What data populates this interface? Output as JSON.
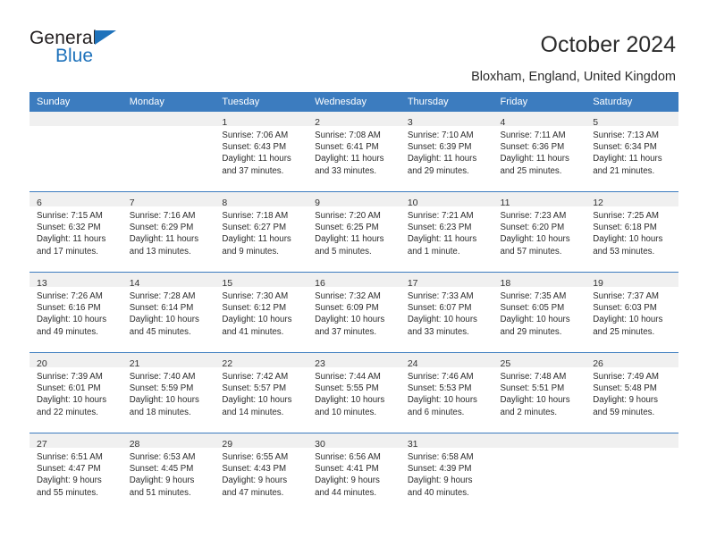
{
  "brand": {
    "name_top": "General",
    "name_bottom": "Blue",
    "accent_color": "#1e72bb",
    "triangle_icon": "triangle-icon"
  },
  "header": {
    "title": "October 2024",
    "location": "Bloxham, England, United Kingdom"
  },
  "calendar": {
    "header_bg": "#3c7cbf",
    "daynum_bg": "#f0f0f0",
    "weekdays": [
      "Sunday",
      "Monday",
      "Tuesday",
      "Wednesday",
      "Thursday",
      "Friday",
      "Saturday"
    ],
    "weeks": [
      [
        {
          "empty": true
        },
        {
          "empty": true
        },
        {
          "day": "1",
          "sunrise": "Sunrise: 7:06 AM",
          "sunset": "Sunset: 6:43 PM",
          "daylight": "Daylight: 11 hours and 37 minutes."
        },
        {
          "day": "2",
          "sunrise": "Sunrise: 7:08 AM",
          "sunset": "Sunset: 6:41 PM",
          "daylight": "Daylight: 11 hours and 33 minutes."
        },
        {
          "day": "3",
          "sunrise": "Sunrise: 7:10 AM",
          "sunset": "Sunset: 6:39 PM",
          "daylight": "Daylight: 11 hours and 29 minutes."
        },
        {
          "day": "4",
          "sunrise": "Sunrise: 7:11 AM",
          "sunset": "Sunset: 6:36 PM",
          "daylight": "Daylight: 11 hours and 25 minutes."
        },
        {
          "day": "5",
          "sunrise": "Sunrise: 7:13 AM",
          "sunset": "Sunset: 6:34 PM",
          "daylight": "Daylight: 11 hours and 21 minutes."
        }
      ],
      [
        {
          "day": "6",
          "sunrise": "Sunrise: 7:15 AM",
          "sunset": "Sunset: 6:32 PM",
          "daylight": "Daylight: 11 hours and 17 minutes."
        },
        {
          "day": "7",
          "sunrise": "Sunrise: 7:16 AM",
          "sunset": "Sunset: 6:29 PM",
          "daylight": "Daylight: 11 hours and 13 minutes."
        },
        {
          "day": "8",
          "sunrise": "Sunrise: 7:18 AM",
          "sunset": "Sunset: 6:27 PM",
          "daylight": "Daylight: 11 hours and 9 minutes."
        },
        {
          "day": "9",
          "sunrise": "Sunrise: 7:20 AM",
          "sunset": "Sunset: 6:25 PM",
          "daylight": "Daylight: 11 hours and 5 minutes."
        },
        {
          "day": "10",
          "sunrise": "Sunrise: 7:21 AM",
          "sunset": "Sunset: 6:23 PM",
          "daylight": "Daylight: 11 hours and 1 minute."
        },
        {
          "day": "11",
          "sunrise": "Sunrise: 7:23 AM",
          "sunset": "Sunset: 6:20 PM",
          "daylight": "Daylight: 10 hours and 57 minutes."
        },
        {
          "day": "12",
          "sunrise": "Sunrise: 7:25 AM",
          "sunset": "Sunset: 6:18 PM",
          "daylight": "Daylight: 10 hours and 53 minutes."
        }
      ],
      [
        {
          "day": "13",
          "sunrise": "Sunrise: 7:26 AM",
          "sunset": "Sunset: 6:16 PM",
          "daylight": "Daylight: 10 hours and 49 minutes."
        },
        {
          "day": "14",
          "sunrise": "Sunrise: 7:28 AM",
          "sunset": "Sunset: 6:14 PM",
          "daylight": "Daylight: 10 hours and 45 minutes."
        },
        {
          "day": "15",
          "sunrise": "Sunrise: 7:30 AM",
          "sunset": "Sunset: 6:12 PM",
          "daylight": "Daylight: 10 hours and 41 minutes."
        },
        {
          "day": "16",
          "sunrise": "Sunrise: 7:32 AM",
          "sunset": "Sunset: 6:09 PM",
          "daylight": "Daylight: 10 hours and 37 minutes."
        },
        {
          "day": "17",
          "sunrise": "Sunrise: 7:33 AM",
          "sunset": "Sunset: 6:07 PM",
          "daylight": "Daylight: 10 hours and 33 minutes."
        },
        {
          "day": "18",
          "sunrise": "Sunrise: 7:35 AM",
          "sunset": "Sunset: 6:05 PM",
          "daylight": "Daylight: 10 hours and 29 minutes."
        },
        {
          "day": "19",
          "sunrise": "Sunrise: 7:37 AM",
          "sunset": "Sunset: 6:03 PM",
          "daylight": "Daylight: 10 hours and 25 minutes."
        }
      ],
      [
        {
          "day": "20",
          "sunrise": "Sunrise: 7:39 AM",
          "sunset": "Sunset: 6:01 PM",
          "daylight": "Daylight: 10 hours and 22 minutes."
        },
        {
          "day": "21",
          "sunrise": "Sunrise: 7:40 AM",
          "sunset": "Sunset: 5:59 PM",
          "daylight": "Daylight: 10 hours and 18 minutes."
        },
        {
          "day": "22",
          "sunrise": "Sunrise: 7:42 AM",
          "sunset": "Sunset: 5:57 PM",
          "daylight": "Daylight: 10 hours and 14 minutes."
        },
        {
          "day": "23",
          "sunrise": "Sunrise: 7:44 AM",
          "sunset": "Sunset: 5:55 PM",
          "daylight": "Daylight: 10 hours and 10 minutes."
        },
        {
          "day": "24",
          "sunrise": "Sunrise: 7:46 AM",
          "sunset": "Sunset: 5:53 PM",
          "daylight": "Daylight: 10 hours and 6 minutes."
        },
        {
          "day": "25",
          "sunrise": "Sunrise: 7:48 AM",
          "sunset": "Sunset: 5:51 PM",
          "daylight": "Daylight: 10 hours and 2 minutes."
        },
        {
          "day": "26",
          "sunrise": "Sunrise: 7:49 AM",
          "sunset": "Sunset: 5:48 PM",
          "daylight": "Daylight: 9 hours and 59 minutes."
        }
      ],
      [
        {
          "day": "27",
          "sunrise": "Sunrise: 6:51 AM",
          "sunset": "Sunset: 4:47 PM",
          "daylight": "Daylight: 9 hours and 55 minutes."
        },
        {
          "day": "28",
          "sunrise": "Sunrise: 6:53 AM",
          "sunset": "Sunset: 4:45 PM",
          "daylight": "Daylight: 9 hours and 51 minutes."
        },
        {
          "day": "29",
          "sunrise": "Sunrise: 6:55 AM",
          "sunset": "Sunset: 4:43 PM",
          "daylight": "Daylight: 9 hours and 47 minutes."
        },
        {
          "day": "30",
          "sunrise": "Sunrise: 6:56 AM",
          "sunset": "Sunset: 4:41 PM",
          "daylight": "Daylight: 9 hours and 44 minutes."
        },
        {
          "day": "31",
          "sunrise": "Sunrise: 6:58 AM",
          "sunset": "Sunset: 4:39 PM",
          "daylight": "Daylight: 9 hours and 40 minutes."
        },
        {
          "empty": true
        },
        {
          "empty": true
        }
      ]
    ]
  }
}
